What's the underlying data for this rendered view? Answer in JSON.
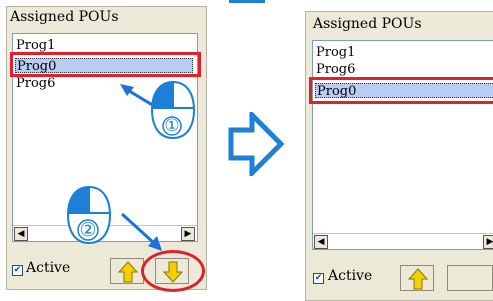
{
  "left_panel": {
    "title": "Assigned POUs",
    "items": [
      "Prog1",
      "Prog0",
      "Prog6"
    ],
    "selected_index": 1,
    "active_label": "Active",
    "active_checked": true
  },
  "right_panel": {
    "title": "Assigned POUs",
    "items": [
      "Prog1",
      "Prog6",
      "Prog0"
    ],
    "selected_index": 2,
    "active_label": "Active",
    "active_checked": true
  },
  "steps": {
    "step1": "①",
    "step2": "②"
  },
  "colors": {
    "highlight": "#e0202c",
    "pointer_arrow": "#1a73d9",
    "mouse_fill": "#1e7fd6",
    "transition_arrow": "#1e7fd6",
    "arrow_button": "#f5d000"
  },
  "icons": {
    "scroll_left": "◀",
    "scroll_right": "▶",
    "check": "✔"
  }
}
